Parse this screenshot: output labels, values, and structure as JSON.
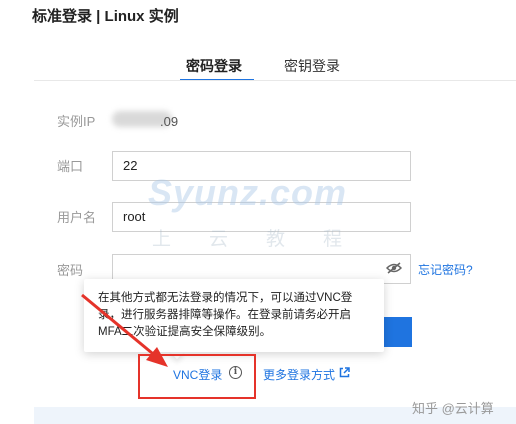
{
  "dialog": {
    "title": "标准登录 | Linux 实例"
  },
  "tabs": [
    {
      "label": "密码登录",
      "active": true
    },
    {
      "label": "密钥登录",
      "active": false
    }
  ],
  "form": {
    "ip_label": "实例IP",
    "ip_value_visible": ".09",
    "port_label": "端口",
    "port_value": "22",
    "username_label": "用户名",
    "username_value": "root",
    "password_label": "密码",
    "password_value": "",
    "forgot_password": "忘记密码?"
  },
  "tooltip": {
    "text": "在其他方式都无法登录的情况下，可以通过VNC登录，进行服务器排障等操作。在登录前请务必开启MFA二次验证提高安全保障级别。"
  },
  "links": {
    "vnc_login": "VNC登录",
    "more_methods": "更多登录方式"
  },
  "watermark": {
    "main": "Syunz.com",
    "sub": "上云教程"
  },
  "footer": {
    "zhihu_credit": "知乎 @云计算"
  },
  "colors": {
    "accent": "#1f74e0",
    "highlight": "#e5332a"
  }
}
